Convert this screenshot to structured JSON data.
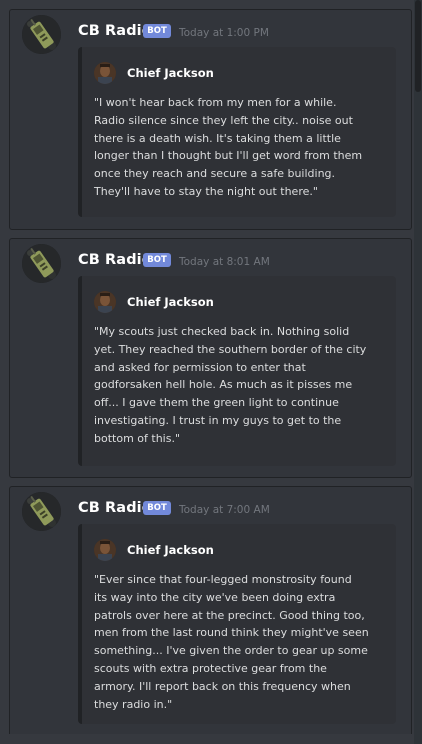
{
  "messages": [
    {
      "username": "CB Radio",
      "badge": "BOT",
      "timestamp": "Today at 1:00 PM",
      "embed_author": "Chief Jackson",
      "lines": [
        "\"I won't hear back from my men for a while.",
        "Radio silence since they left the city.. noise out",
        "there is a death wish. It's taking them a little",
        "longer than I thought but I'll get word from them",
        "once they reach and secure a safe building.",
        "They'll have to stay the night out there.\""
      ]
    },
    {
      "username": "CB Radio",
      "badge": "BOT",
      "timestamp": "Today at 8:01 AM",
      "embed_author": "Chief Jackson",
      "lines": [
        "\"My scouts just checked back in. Nothing solid",
        "yet. They reached the southern border of the city",
        "and asked for permission to enter that",
        "godforsaken hell hole. As much as it pisses me",
        "off... I gave them the green light to continue",
        "investigating. I trust in my guys to get to the",
        "bottom of this.\""
      ]
    },
    {
      "username": "CB Radio",
      "badge": "BOT",
      "timestamp": "Today at 7:00 AM",
      "embed_author": "Chief Jackson",
      "lines": [
        "\"Ever since that four-legged monstrosity found",
        "its way into the city we've been doing extra",
        "patrols over here at the precinct. Good thing too,",
        "men from the last round think they might've seen",
        "something... I've given the order to gear up some",
        "scouts with extra protective gear from the",
        "armory. I'll report back on this frequency when",
        "they radio in.\""
      ]
    }
  ],
  "colors": {
    "background": "#36393f",
    "card": "#32353b",
    "embed": "#2f3136",
    "badge": "#7289da",
    "text": "#dcddde",
    "timestamp": "#72767d"
  }
}
